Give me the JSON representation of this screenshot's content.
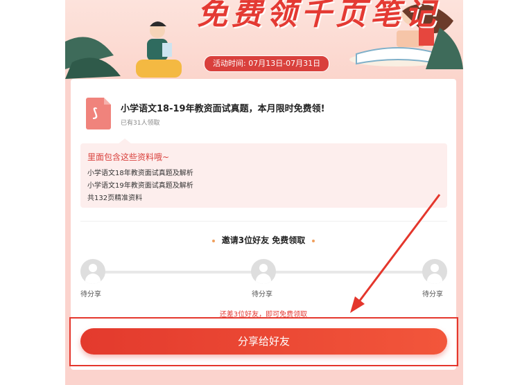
{
  "banner": {
    "title": "免费领千页笔记",
    "activity_time": "活动时间: 07月13日-07月31日"
  },
  "document": {
    "icon": "pdf-icon",
    "title": "小学语文18-19年教资面试真题，本月限时免费领!",
    "claimed_count": "已有31人领取"
  },
  "contents": {
    "heading": "里面包含这些资料哦~",
    "items": [
      "小学语文18年教资面试真题及解析",
      "小学语文19年教资面试真题及解析",
      "共132页精准资料"
    ]
  },
  "invite": {
    "title": "邀请3位好友 免费领取",
    "slots": [
      {
        "label": "待分享"
      },
      {
        "label": "待分享"
      },
      {
        "label": "待分享"
      }
    ],
    "remaining_text": "还差3位好友，即可免费领取"
  },
  "share_button": {
    "label": "分享给好友"
  },
  "colors": {
    "accent": "#e43a33",
    "background": "#fbd3cd",
    "annotation": "#e4362c"
  }
}
